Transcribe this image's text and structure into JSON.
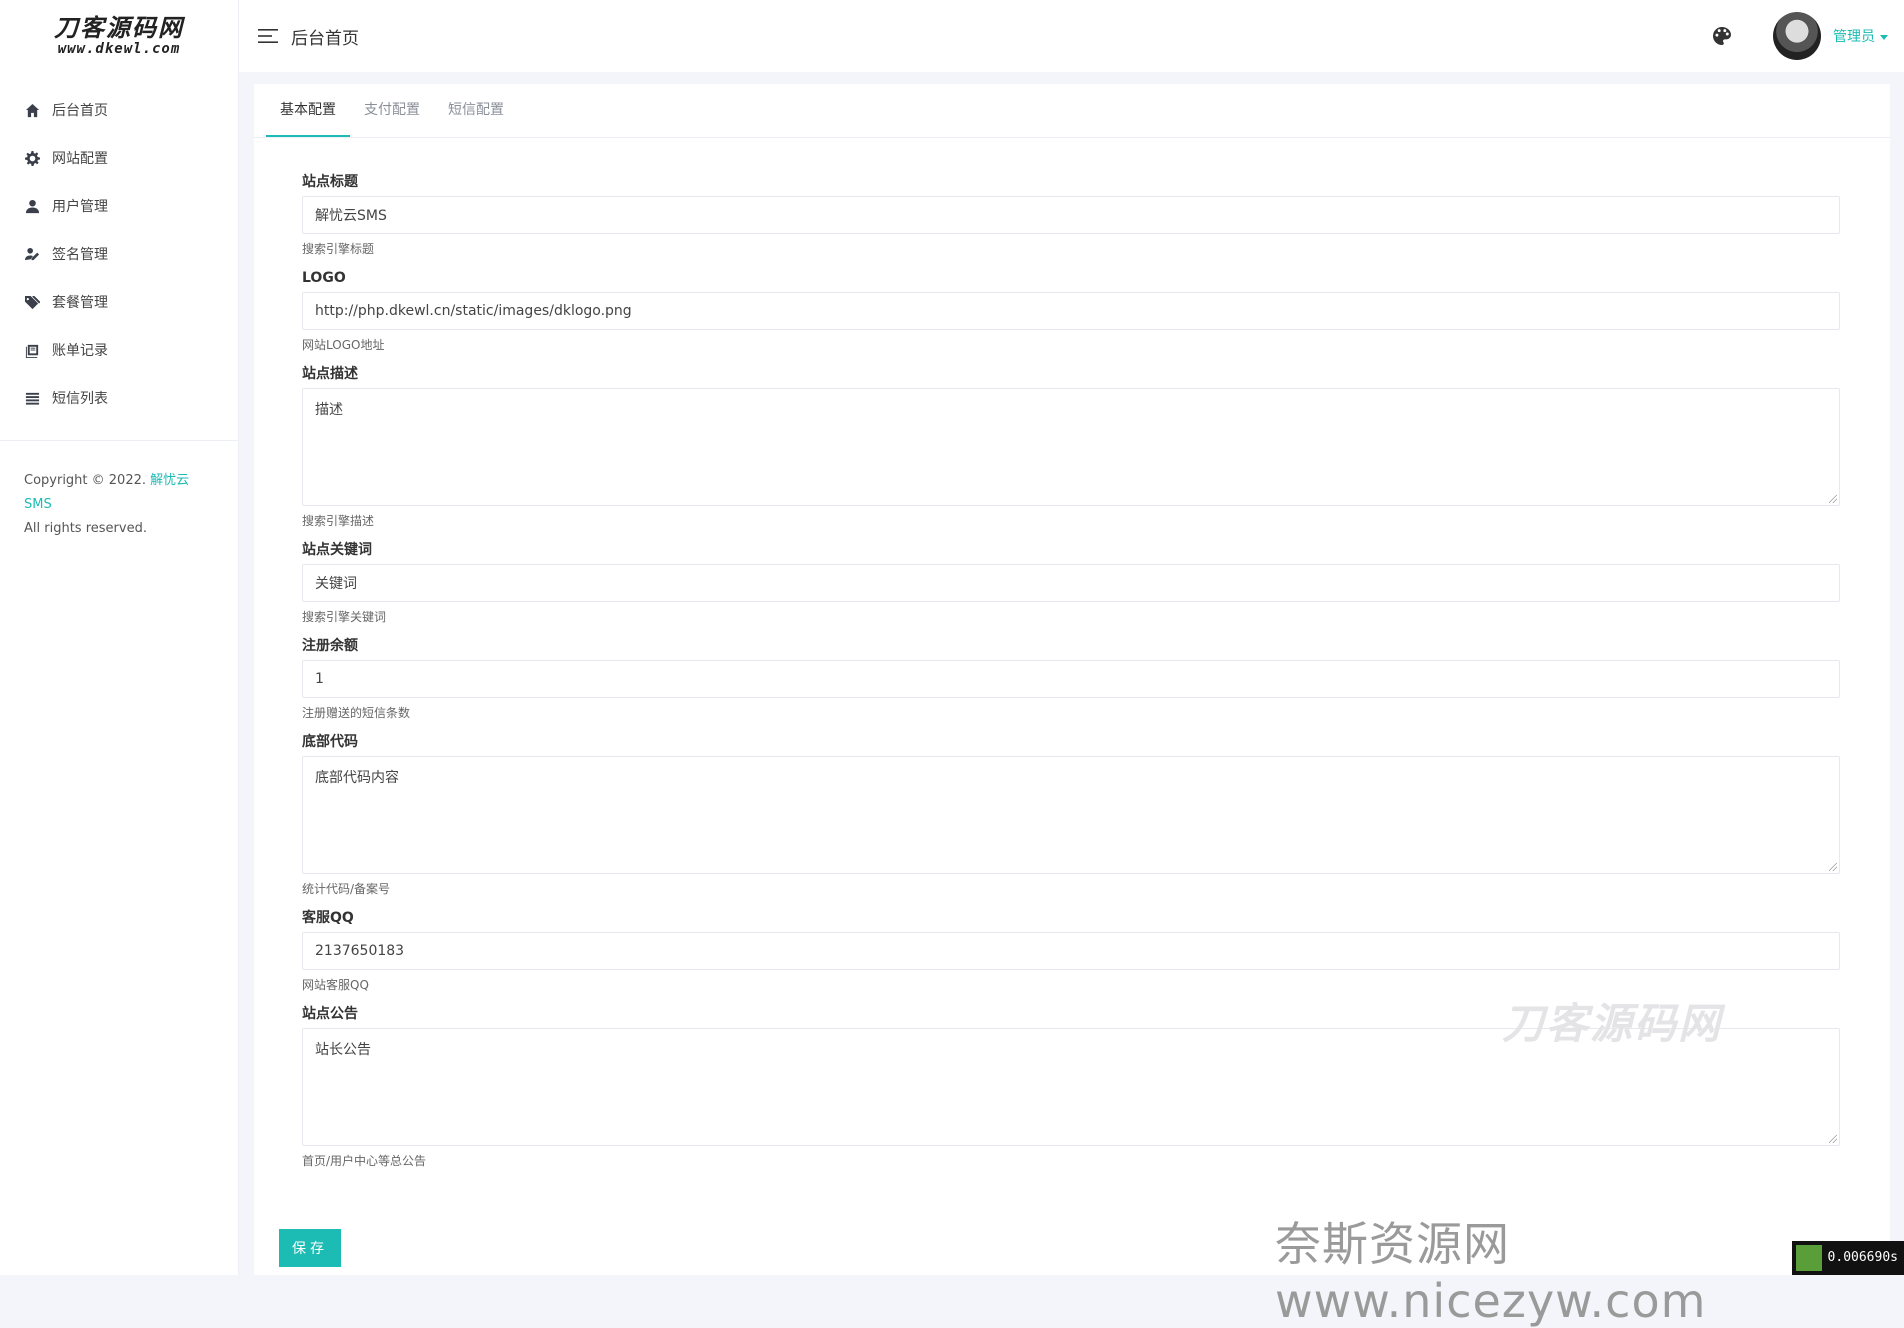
{
  "brand": {
    "logo_main": "刀客源码网",
    "logo_sub": "www.dkewl.com"
  },
  "sidebar": {
    "items": [
      {
        "label": "后台首页",
        "icon": "home-icon"
      },
      {
        "label": "网站配置",
        "icon": "gear-icon"
      },
      {
        "label": "用户管理",
        "icon": "user-icon"
      },
      {
        "label": "签名管理",
        "icon": "signature-icon"
      },
      {
        "label": "套餐管理",
        "icon": "tags-icon"
      },
      {
        "label": "账单记录",
        "icon": "book-icon"
      },
      {
        "label": "短信列表",
        "icon": "list-icon"
      }
    ],
    "copyright_prefix": "Copyright © 2022.",
    "copyright_brand": "解忧云SMS",
    "copyright_suffix": "All rights reserved."
  },
  "header": {
    "page_title": "后台首页",
    "user_name": "管理员"
  },
  "tabs": [
    {
      "label": "基本配置",
      "active": true
    },
    {
      "label": "支付配置",
      "active": false
    },
    {
      "label": "短信配置",
      "active": false
    }
  ],
  "form": {
    "site_title": {
      "label": "站点标题",
      "value": "解忧云SMS",
      "help": "搜索引擎标题"
    },
    "logo": {
      "label": "LOGO",
      "value": "http://php.dkewl.cn/static/images/dklogo.png",
      "help": "网站LOGO地址"
    },
    "site_desc": {
      "label": "站点描述",
      "value": "描述",
      "help": "搜索引擎描述"
    },
    "site_keywords": {
      "label": "站点关键词",
      "value": "关键词",
      "help": "搜索引擎关键词"
    },
    "register_balance": {
      "label": "注册余额",
      "value": "1",
      "help": "注册赠送的短信条数"
    },
    "footer_code": {
      "label": "底部代码",
      "value": "底部代码内容",
      "help": "统计代码/备案号"
    },
    "service_qq": {
      "label": "客服QQ",
      "value": "2137650183",
      "help": "网站客服QQ"
    },
    "site_notice": {
      "label": "站点公告",
      "value": "站长公告",
      "help": "首页/用户中心等总公告"
    },
    "save_label": "保存"
  },
  "watermarks": {
    "center": "刀客源码网",
    "bottom": "奈斯资源网www.nicezyw.com"
  },
  "timer": "0.006690s",
  "colors": {
    "accent": "#1cbbb4",
    "background": "#f4f5fa"
  }
}
